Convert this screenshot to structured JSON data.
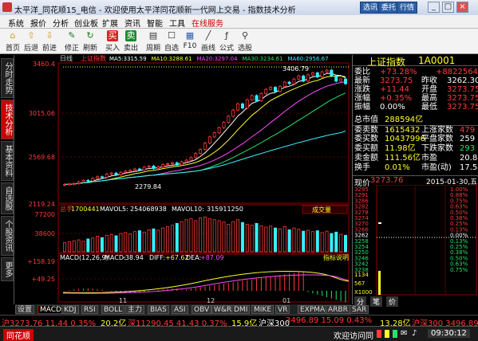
{
  "window": {
    "title": "太平洋_同花顺15_电信 - 欢迎使用太平洋同花顺新一代网上交易 - 指数技术分析",
    "buttons": [
      "选讯",
      "委托",
      "行情"
    ]
  },
  "menu": [
    "系统",
    "报价",
    "分析",
    "创业板",
    "扩展",
    "资讯",
    "智能",
    "工具",
    "在线服务"
  ],
  "toolbar": [
    {
      "label": "首页",
      "icon": "home-icon"
    },
    {
      "label": "后退",
      "icon": "back-icon"
    },
    {
      "label": "前进",
      "icon": "forward-icon"
    },
    {
      "label": "修正",
      "icon": "edit-icon"
    },
    {
      "label": "刷新",
      "icon": "refresh-icon"
    },
    {
      "label": "买入",
      "icon": "buy-icon"
    },
    {
      "label": "卖出",
      "icon": "sell-icon"
    },
    {
      "label": "周期",
      "icon": "period-icon"
    },
    {
      "label": "自选",
      "icon": "favorite-icon"
    },
    {
      "label": "F10",
      "icon": "f10-icon"
    },
    {
      "label": "画线",
      "icon": "draw-line-icon"
    },
    {
      "label": "公式",
      "icon": "formula-icon"
    },
    {
      "label": "选股",
      "icon": "stock-pick-icon"
    }
  ],
  "left_tabs": [
    "分时走势",
    "技术分析",
    "基本资料",
    "自选股",
    "个股资讯",
    "更多"
  ],
  "chart": {
    "period": "日线",
    "name": "上证指数",
    "ma": [
      {
        "label": "MA5:",
        "value": "3315.59",
        "color": "#ffffff"
      },
      {
        "label": "MA10:",
        "value": "3288.61",
        "color": "#ffff2a"
      },
      {
        "label": "MA20:",
        "value": "3297.04",
        "color": "#ff4bff"
      },
      {
        "label": "MA30:",
        "value": "3234.61",
        "color": "#23e36b"
      },
      {
        "label": "MA60:",
        "value": "2956.67",
        "color": "#36f0ff"
      }
    ],
    "price_ticks": [
      "3460.4",
      "3015.06",
      "2569.68",
      "2119.24"
    ],
    "high_label": "3406.79",
    "low_label": "2279.84",
    "volume": {
      "label": "总手",
      "value": "1700441",
      "mavol5_label": "MAVOL5:",
      "mavol5": "254068938",
      "mavol10_label": "MAVOL10:",
      "mavol10": "315911250",
      "dropdown": "成交量",
      "ticks": [
        "77200",
        "38600",
        "X100"
      ]
    },
    "macd": {
      "label": "MACD(12,26,9)",
      "macd_label": "MACD:",
      "macd": "-38.94",
      "diff_label": "DIFF:",
      "diff": "+67.62",
      "dea_label": "DEA:",
      "dea": "+87.09",
      "help": "指标说明",
      "ticks": [
        "+158.19",
        "+49.25"
      ]
    },
    "x_ticks": [
      "11",
      "12",
      "01"
    ]
  },
  "chart_data": {
    "type": "candlestick",
    "ylim": [
      2119.24,
      3460.4
    ],
    "close": [
      2300,
      2305,
      2310,
      2325,
      2340,
      2335,
      2360,
      2375,
      2370,
      2400,
      2410,
      2395,
      2418,
      2428,
      2436,
      2450,
      2441,
      2468,
      2478,
      2455,
      2470,
      2492,
      2500,
      2510,
      2489,
      2520,
      2535,
      2560,
      2600,
      2640,
      2700,
      2760,
      2800,
      2850,
      2900,
      2960,
      3020,
      3080,
      3040,
      3120,
      3160,
      3110,
      3180,
      3220,
      3240,
      3200,
      3250,
      3290,
      3275,
      3320,
      3350,
      3300,
      3360,
      3380,
      3340,
      3390,
      3406,
      3350,
      3300,
      3320,
      3275
    ],
    "volume_bars": [
      20,
      22,
      24,
      26,
      23,
      28,
      30,
      34,
      31,
      36,
      38,
      35,
      40,
      42,
      39,
      44,
      46,
      43,
      48,
      50,
      47,
      52,
      55,
      58,
      62,
      66,
      70,
      72,
      68,
      74,
      76,
      72,
      70,
      68,
      65,
      60,
      66,
      70,
      64,
      60,
      58,
      62,
      57,
      54,
      56,
      52,
      50,
      55,
      48,
      52,
      49,
      45,
      47,
      44,
      46,
      42,
      45,
      40,
      43,
      38,
      36
    ]
  },
  "quote": {
    "title": "上证指数",
    "code": "1A0001",
    "rows": [
      {
        "l1": "委比",
        "v1": "+73.28%",
        "c1": "#ff3b3b",
        "l2": "",
        "v2": "+8822564",
        "c2": "#ff3b3b"
      },
      {
        "l1": "最新",
        "v1": "3273.75",
        "c1": "#ff3b3b",
        "l2": "昨收",
        "v2": "3262.30",
        "c2": "#ffffff"
      },
      {
        "l1": "涨跌",
        "v1": "+11.44",
        "c1": "#ff3b3b",
        "l2": "开盘",
        "v2": "3273.75",
        "c2": "#ff3b3b"
      },
      {
        "l1": "涨幅",
        "v1": "+0.35%",
        "c1": "#ff3b3b",
        "l2": "最高",
        "v2": "3273.75",
        "c2": "#ff3b3b"
      },
      {
        "l1": "振幅",
        "v1": "0.00%",
        "c1": "#ffffff",
        "l2": "最低",
        "v2": "3273.75",
        "c2": "#ff3b3b"
      }
    ],
    "rows2": [
      {
        "l1": "总市值",
        "v1": "288594亿",
        "c1": "#ffff2a",
        "l2": "",
        "v2": "",
        "c2": "#ffff2a"
      },
      {
        "l1": "委卖数",
        "v1": "1615432",
        "c1": "#ffff2a",
        "l2": "上涨家数",
        "v2": "479",
        "c2": "#ff3b3b"
      },
      {
        "l1": "委买数",
        "v1": "10437996",
        "c1": "#ffff2a",
        "l2": "平盘家数",
        "v2": "259",
        "c2": "#ffffff"
      },
      {
        "l1": "委买额",
        "v1": "11.98亿",
        "c1": "#ffff2a",
        "l2": "下跌家数",
        "v2": "293",
        "c2": "#23e36b"
      },
      {
        "l1": "卖金额",
        "v1": "111.56亿",
        "c1": "#ffff2a",
        "l2": "市盈",
        "v2": "20.85",
        "c2": "#ffffff"
      },
      {
        "l1": "换手",
        "v1": "0.01%",
        "c1": "#ffff2a",
        "l2": "市盈(动)",
        "v2": "17.54",
        "c2": "#ffffff"
      }
    ],
    "mini_header": {
      "label": "现价",
      "value": "3273.76",
      "date": "2015-01-30,五"
    },
    "mini_ticks": [
      {
        "v": "3295",
        "p": "1.00%",
        "c": "#ff3b3b"
      },
      {
        "v": "3291",
        "p": "0.88%",
        "c": "#ff3b3b"
      },
      {
        "v": "3286",
        "p": "0.75%",
        "c": "#ff3b3b"
      },
      {
        "v": "3282",
        "p": "0.63%",
        "c": "#ff3b3b"
      },
      {
        "v": "3278",
        "p": "0.50%",
        "c": "#ff3b3b"
      },
      {
        "v": "3274",
        "p": "0.38%",
        "c": "#ff3b3b"
      },
      {
        "v": "3270",
        "p": "0.25%",
        "c": "#ff3b3b"
      },
      {
        "v": "3266",
        "p": "0.13%",
        "c": "#ff3b3b"
      },
      {
        "v": "3262",
        "p": "0.00%",
        "c": "#ffffff"
      },
      {
        "v": "3258",
        "p": "0.13%",
        "c": "#23e36b"
      },
      {
        "v": "3254",
        "p": "0.25%",
        "c": "#23e36b"
      },
      {
        "v": "3250",
        "p": "0.38%",
        "c": "#23e36b"
      },
      {
        "v": "3246",
        "p": "0.50%",
        "c": "#23e36b"
      },
      {
        "v": "3242",
        "p": "0.63%",
        "c": "#23e36b"
      },
      {
        "v": "3238",
        "p": "0.75%",
        "c": "#23e36b"
      }
    ],
    "mini_bottom": [
      "1134",
      "567",
      "X1000"
    ],
    "tabs": [
      "分",
      "笔",
      "价"
    ]
  },
  "bottom_tabs": [
    "设置",
    "MACD",
    "KDJ",
    "RSI",
    "BOLL",
    "主力",
    "BIAS",
    "ASI",
    "OBV",
    "W&R",
    "DMI",
    "MIKE",
    "VR",
    "EXPMA",
    "ARBR",
    "SAR"
  ],
  "status": {
    "items": [
      {
        "t": "沪3273.76 11.44 0.35%",
        "c": "#ff3b3b"
      },
      {
        "t": "20.2亿",
        "c": "#ffff2a"
      },
      {
        "t": "深11290.45 41.43 0.37%",
        "c": "#ff3b3b"
      },
      {
        "t": "15.9亿",
        "c": "#ffff2a"
      },
      {
        "t": "沪深300",
        "c": "#ffffff"
      },
      {
        "t": "3496.89 15.09 0.43%",
        "c": "#ff3b3b"
      },
      {
        "t": "13.28亿",
        "c": "#ffff2a"
      },
      {
        "t": "沪深300 3496.89 15.09 0.43%",
        "c": "#ff3b3b"
      }
    ]
  },
  "footer": {
    "left": "同花顺",
    "link": "欢迎访问同",
    "time": "09:30:12"
  }
}
